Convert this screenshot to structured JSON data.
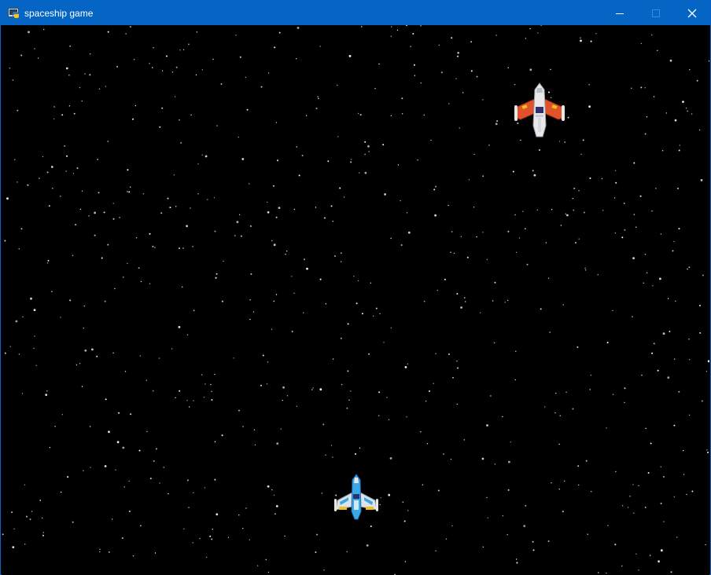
{
  "window": {
    "title": "spaceship game",
    "titlebar_color": "#0565c4",
    "controls": [
      "minimize",
      "maximize",
      "close"
    ]
  },
  "game": {
    "background_color": "#000000",
    "enemy_ship": {
      "icon": "red-spaceship-icon",
      "colors": {
        "wing": "#e0522a",
        "body": "#e8e8e8",
        "accent": "#f0c020"
      }
    },
    "player_ship": {
      "icon": "blue-spaceship-icon",
      "colors": {
        "body": "#e8e8e8",
        "accent": "#3aa8e8",
        "engine": "#f0c020"
      }
    }
  }
}
